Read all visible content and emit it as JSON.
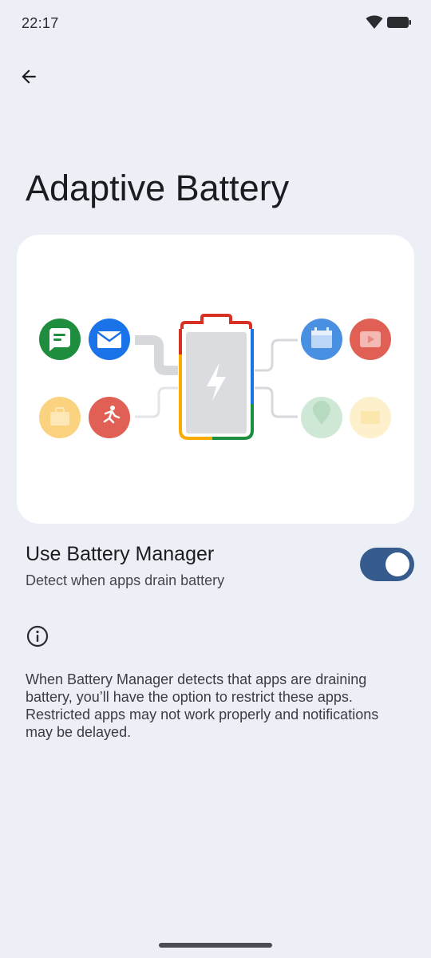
{
  "status_bar": {
    "time": "22:17"
  },
  "header": {
    "title": "Adaptive Battery"
  },
  "illustration": {
    "left_icons": [
      "messages-icon",
      "email-icon",
      "work-briefcase-icon",
      "fitness-run-icon"
    ],
    "right_icons": [
      "calendar-icon",
      "video-icon",
      "maps-icon",
      "card-icon"
    ],
    "battery_colors": {
      "red": "#d93025",
      "blue": "#1a73e8",
      "yellow": "#f9ab00",
      "green": "#1e8e3e"
    }
  },
  "setting": {
    "title": "Use Battery Manager",
    "summary": "Detect when apps drain battery",
    "enabled": true,
    "accent": "#365c8e"
  },
  "info": {
    "text": "When Battery Manager detects that apps are draining battery, you’ll have the option to restrict these apps. Restricted apps may not work properly and notifications may be delayed."
  }
}
